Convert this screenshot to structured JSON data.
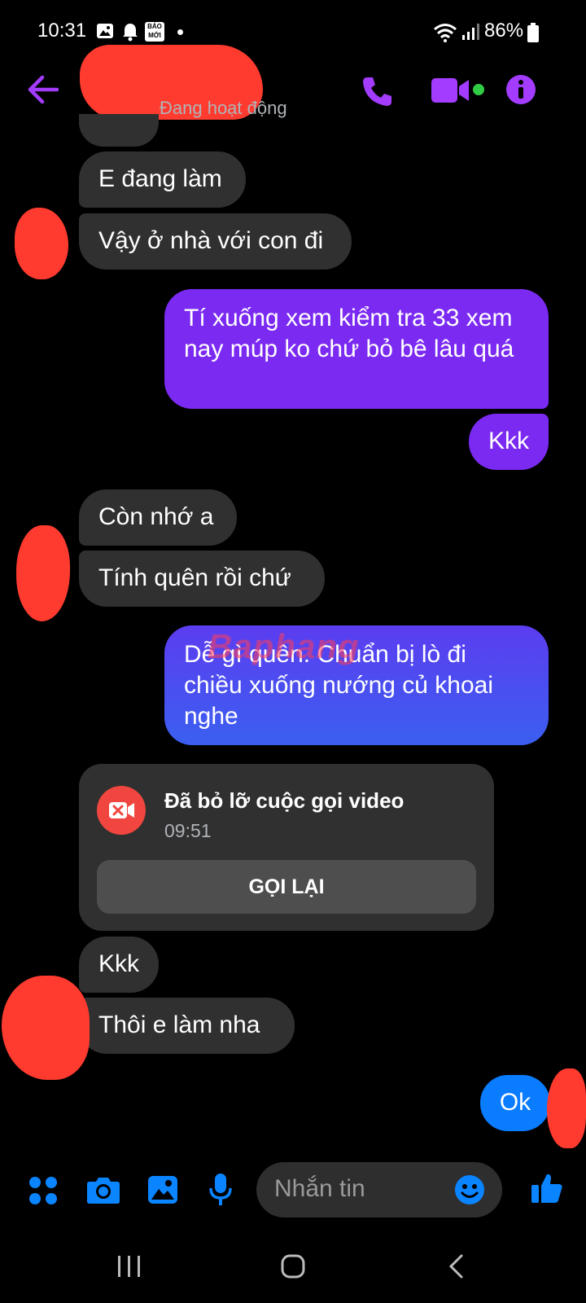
{
  "status_bar": {
    "time": "10:31",
    "battery": "86%",
    "app_badge": "BÁO MỚI",
    "icons": [
      "image-icon",
      "bell-icon",
      "bao-moi-icon",
      "dot-icon",
      "wifi-icon",
      "signal-icon",
      "battery-icon"
    ]
  },
  "header": {
    "presence": "Đang hoạt động",
    "icons": [
      "back-arrow-icon",
      "phone-icon",
      "video-camera-icon",
      "online-dot",
      "info-icon"
    ],
    "accent": "#8a2be2"
  },
  "messages": [
    {
      "side": "in",
      "text": "E đang làm"
    },
    {
      "side": "in",
      "text": "Vậy ở nhà với con đi"
    },
    {
      "side": "out",
      "text": "Tí xuống xem kiểm tra 33 xem nay múp ko chứ bỏ bê lâu quá"
    },
    {
      "side": "out",
      "text": "Kkk"
    },
    {
      "side": "in",
      "text": "Còn nhớ a"
    },
    {
      "side": "in",
      "text": "Tính quên rồi chứ"
    },
    {
      "side": "out",
      "text": "Dễ gì quên. Chuẩn bị lò đi chiều xuống nướng củ khoai nghe"
    },
    {
      "side": "in",
      "text": "Kkk"
    },
    {
      "side": "in",
      "text": "Thôi e làm nha"
    },
    {
      "side": "out",
      "text": "Ok"
    }
  ],
  "missed_call": {
    "title": "Đã bỏ lỡ cuộc gọi video",
    "time": "09:51",
    "button": "GỌI LẠI"
  },
  "watermark": "Baphang",
  "composer": {
    "placeholder": "Nhắn tin",
    "icons": [
      "menu-dots-icon",
      "camera-icon",
      "gallery-icon",
      "microphone-icon",
      "emoji-icon",
      "thumbs-up-icon"
    ]
  },
  "colors": {
    "outgoing_purple": "#7b2af2",
    "outgoing_blue": "#3b5ff0",
    "ok_blue": "#0a7cff",
    "incoming_gray": "#303030",
    "missed_call_red": "#f0463f",
    "icon_blue": "#0a84ff"
  }
}
